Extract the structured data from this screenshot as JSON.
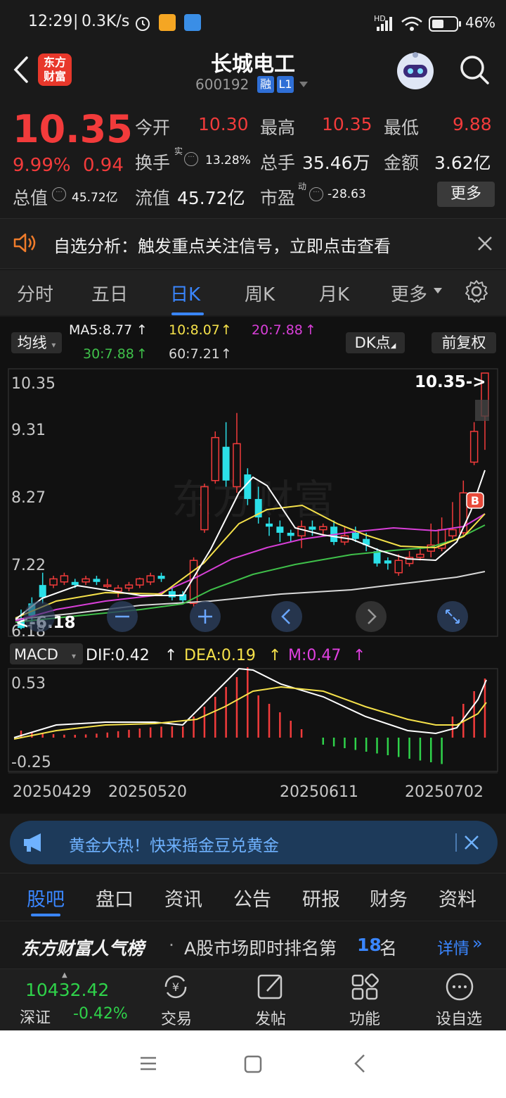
{
  "status": {
    "time": "12:29",
    "speed": "0.3K/s",
    "network": "HD",
    "battery": "46"
  },
  "header": {
    "logo_line1": "东方",
    "logo_line2": "财富",
    "stock_name": "长城电工",
    "stock_code": "600192",
    "tag1": "融",
    "tag2": "L1"
  },
  "quote": {
    "price": "10.35",
    "pct_change": "9.99%",
    "change": "0.94",
    "open_label": "今开",
    "open_value": "10.30",
    "high_label": "最高",
    "high_value": "10.35",
    "low_label": "最低",
    "low_value": "9.88",
    "turnover_label": "换手",
    "turnover_sup": "实",
    "turnover_value": "13.28%",
    "volume_label": "总手",
    "volume_value": "35.46万",
    "amount_label": "金额",
    "amount_value": "3.62亿",
    "mktcap_label": "总值",
    "mktcap_value": "45.72亿",
    "float_label": "流值",
    "float_value": "45.72亿",
    "pe_label": "市盈",
    "pe_sup": "动",
    "pe_value": "-28.63",
    "more_button": "更多"
  },
  "notice": {
    "text": "自选分析：触发重点关注信号，立即点击查看"
  },
  "kline_tabs": [
    "分时",
    "五日",
    "日K",
    "周K",
    "月K",
    "更多"
  ],
  "chart": {
    "ma_selector": "均线",
    "ma5": "MA5:8.77",
    "ma10": "10:8.07",
    "ma20": "20:7.88",
    "ma30": "30:7.88",
    "ma60": "60:7.21",
    "dk_button": "DK点",
    "adjust_button": "前复权",
    "y_labels": [
      "10.35",
      "9.31",
      "8.27",
      "7.22",
      "6.18"
    ],
    "max_label": "10.35->",
    "min_label": "<-6.18",
    "macd_selector": "MACD",
    "dif": "DIF:0.42",
    "dea": "DEA:0.19",
    "m": "M:0.47",
    "macd_y": [
      "0.53",
      "-0.25"
    ],
    "dates": [
      "20250429",
      "20250520",
      "20250611",
      "20250702"
    ],
    "buy_marker": "B",
    "watermark": "东方财富"
  },
  "chart_data": {
    "type": "candlestick",
    "ylim": [
      6.18,
      10.35
    ],
    "candles": [
      [
        6.3,
        6.2,
        6.5,
        6.18
      ],
      [
        6.6,
        6.4,
        6.7,
        6.3
      ],
      [
        6.9,
        6.7,
        7.1,
        6.6
      ],
      [
        6.9,
        7.0,
        7.05,
        6.85
      ],
      [
        6.95,
        7.05,
        7.1,
        6.9
      ],
      [
        6.95,
        6.9,
        7.0,
        6.85
      ],
      [
        6.95,
        7.0,
        7.05,
        6.9
      ],
      [
        7.0,
        6.95,
        7.05,
        6.9
      ],
      [
        6.9,
        6.9,
        7.0,
        6.85
      ],
      [
        6.8,
        6.85,
        6.9,
        6.7
      ],
      [
        6.85,
        6.9,
        6.95,
        6.8
      ],
      [
        6.9,
        7.0,
        7.02,
        6.85
      ],
      [
        6.95,
        7.05,
        7.1,
        6.9
      ],
      [
        7.05,
        7.0,
        7.1,
        6.95
      ],
      [
        6.8,
        6.7,
        6.85,
        6.65
      ],
      [
        6.75,
        6.65,
        6.8,
        6.6
      ],
      [
        6.6,
        7.3,
        7.35,
        6.55
      ],
      [
        7.8,
        8.5,
        8.55,
        7.75
      ],
      [
        8.6,
        9.3,
        9.4,
        8.55
      ],
      [
        9.15,
        8.6,
        9.55,
        8.5
      ],
      [
        8.5,
        9.2,
        9.7,
        8.4
      ],
      [
        8.7,
        8.3,
        8.8,
        8.2
      ],
      [
        8.3,
        8.0,
        8.5,
        7.9
      ],
      [
        7.9,
        7.85,
        8.0,
        7.7
      ],
      [
        7.85,
        7.75,
        7.95,
        7.6
      ],
      [
        7.75,
        7.7,
        7.8,
        7.6
      ],
      [
        7.7,
        7.85,
        7.95,
        7.5
      ],
      [
        7.85,
        7.8,
        7.95,
        7.7
      ],
      [
        7.8,
        7.85,
        7.9,
        7.7
      ],
      [
        7.85,
        7.6,
        7.95,
        7.55
      ],
      [
        7.6,
        7.7,
        7.85,
        7.55
      ],
      [
        7.75,
        7.65,
        7.85,
        7.6
      ],
      [
        7.65,
        7.55,
        7.75,
        7.45
      ],
      [
        7.45,
        7.25,
        7.5,
        7.2
      ],
      [
        7.3,
        7.25,
        7.35,
        7.15
      ],
      [
        7.1,
        7.3,
        7.4,
        7.05
      ],
      [
        7.25,
        7.35,
        7.45,
        7.2
      ],
      [
        7.35,
        7.4,
        7.5,
        7.3
      ],
      [
        7.45,
        7.55,
        7.9,
        7.35
      ],
      [
        7.5,
        7.8,
        8.0,
        7.45
      ],
      [
        7.7,
        7.8,
        8.25,
        7.65
      ],
      [
        7.75,
        8.4,
        8.6,
        7.7
      ],
      [
        8.9,
        9.4,
        9.55,
        8.85
      ],
      [
        9.65,
        10.35,
        10.35,
        9.1
      ]
    ]
  },
  "gold_banner": {
    "text": "黄金大热！快来摇金豆兑黄金"
  },
  "bottom_tabs": [
    "股吧",
    "盘口",
    "资讯",
    "公告",
    "研报",
    "财务",
    "资料"
  ],
  "ranking": {
    "title": "东方财富人气榜",
    "prefix": "A股市场即时排名第",
    "rank": "18",
    "suffix": "名",
    "detail": "详情"
  },
  "index": {
    "value": "10432.42",
    "name": "深证",
    "change": "-0.42%"
  },
  "actions": [
    "交易",
    "发帖",
    "功能",
    "设自选"
  ]
}
